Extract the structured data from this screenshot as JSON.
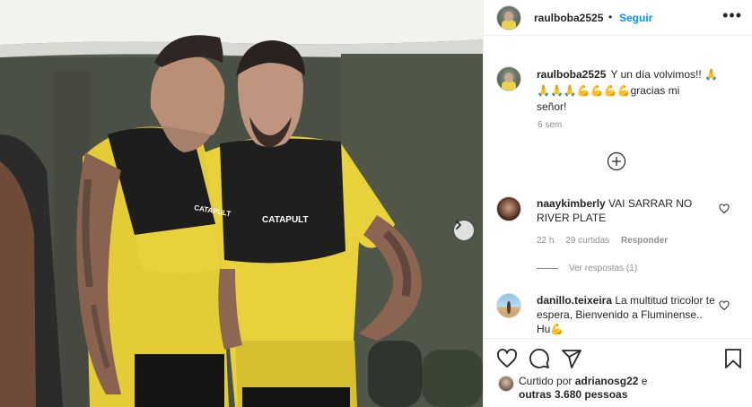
{
  "post": {
    "owner": "raulboba2525",
    "follow_label": "Seguir",
    "more_label": "•••",
    "caption_lines": [
      "Y un día volvimos!! 🙏",
      "🙏🙏🙏💪💪💪💪gracias mi",
      "señor!"
    ],
    "time_ago": "6 sem",
    "photo_text": {
      "shirt_left": "CATAPULT",
      "shirt_right": "CATAPULT"
    }
  },
  "comments": [
    {
      "username": "naaykimberly",
      "text": "VAI SARRAR NO RIVER PLATE",
      "time": "22 h",
      "likes": "29 curtidas",
      "reply_label": "Responder",
      "view_replies": "Ver respostas (1)"
    },
    {
      "username": "danillo.teixeira",
      "text": "La multitud tricolor te espera, Bienvenido a Fluminense.. Hu💪",
      "time": "",
      "likes": "",
      "reply_label": "",
      "view_replies": ""
    }
  ],
  "actions": {
    "like_icon": "heart-icon",
    "comment_icon": "comment-icon",
    "share_icon": "share-icon",
    "save_icon": "bookmark-icon"
  },
  "likes_summary": {
    "prefix": "Curtido por",
    "user": "adrianosg22",
    "middle": "e",
    "others": "outras 3.680 pessoas"
  },
  "colors": {
    "accent": "#0095f6",
    "jersey": "#e8d13a",
    "text_secondary": "#8e8e8e"
  }
}
